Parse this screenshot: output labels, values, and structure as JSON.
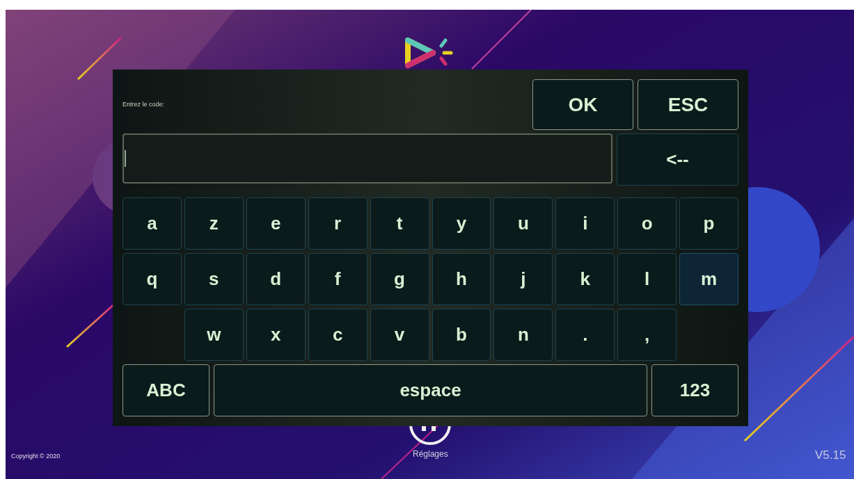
{
  "dialog": {
    "prompt": "Entrez le code:",
    "actions": [
      {
        "label": "OK"
      },
      {
        "label": "ESC"
      }
    ],
    "backspace": "<--",
    "rows": [
      {
        "indent": false,
        "keys": [
          {
            "label": "a",
            "selected": false
          },
          {
            "label": "z",
            "selected": false
          },
          {
            "label": "e",
            "selected": false
          },
          {
            "label": "r",
            "selected": false
          },
          {
            "label": "t",
            "selected": false
          },
          {
            "label": "y",
            "selected": false
          },
          {
            "label": "u",
            "selected": false
          },
          {
            "label": "i",
            "selected": false
          },
          {
            "label": "o",
            "selected": false
          },
          {
            "label": "p",
            "selected": false
          }
        ]
      },
      {
        "indent": false,
        "keys": [
          {
            "label": "q",
            "selected": false
          },
          {
            "label": "s",
            "selected": false
          },
          {
            "label": "d",
            "selected": false
          },
          {
            "label": "f",
            "selected": false
          },
          {
            "label": "g",
            "selected": false
          },
          {
            "label": "h",
            "selected": false
          },
          {
            "label": "j",
            "selected": false
          },
          {
            "label": "k",
            "selected": false
          },
          {
            "label": "l",
            "selected": false
          },
          {
            "label": "m",
            "selected": true
          }
        ]
      },
      {
        "indent": true,
        "keys": [
          {
            "label": "w",
            "selected": false
          },
          {
            "label": "x",
            "selected": false
          },
          {
            "label": "c",
            "selected": false
          },
          {
            "label": "v",
            "selected": false
          },
          {
            "label": "b",
            "selected": false
          },
          {
            "label": "n",
            "selected": false
          },
          {
            "label": ".",
            "selected": false
          },
          {
            "label": ",",
            "selected": false
          }
        ]
      }
    ],
    "bottom_keys": [
      {
        "label": "ABC"
      },
      {
        "label": "espace"
      },
      {
        "label": "123"
      }
    ]
  },
  "footer": {
    "copyright": "Copyright © 2020",
    "settings_label": "Réglages",
    "version": "V5.15"
  }
}
